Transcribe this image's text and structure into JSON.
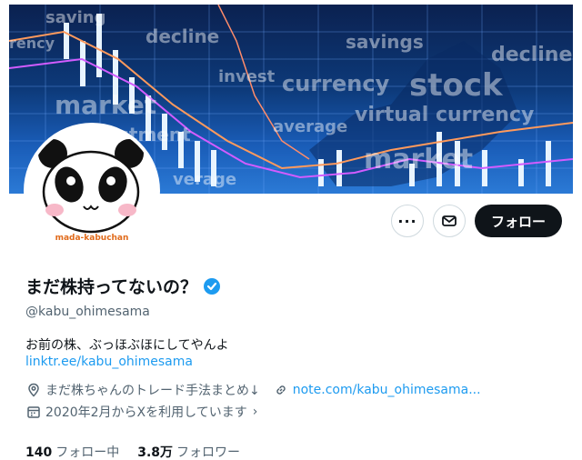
{
  "banner": {
    "words": [
      "saving",
      "decline",
      "savings",
      "decline",
      "stock",
      "currency",
      "invest",
      "market",
      "virtual currency",
      "average",
      "market",
      "stment",
      "verage",
      "rency"
    ]
  },
  "avatar": {
    "caption": "mada-kabuchan"
  },
  "actions": {
    "follow_label": "フォロー"
  },
  "profile": {
    "display_name": "まだ株持ってないの？",
    "handle": "@kabu_ohimesama",
    "bio": "お前の株、ぶっほぶほにしてやんよ",
    "bio_link": "linktr.ee/kabu_ohimesama",
    "category": "まだ株ちゃんのトレード手法まとめ↓",
    "website": "note.com/kabu_ohimesama...",
    "joined": "2020年2月からXを利用しています"
  },
  "stats": {
    "following_count": "140",
    "following_label": "フォロー中",
    "followers_count": "3.8万",
    "followers_label": "フォロワー"
  },
  "colors": {
    "accent": "#1d9bf0",
    "verified": "#1d9bf0",
    "follow_bg": "#0f1419"
  }
}
